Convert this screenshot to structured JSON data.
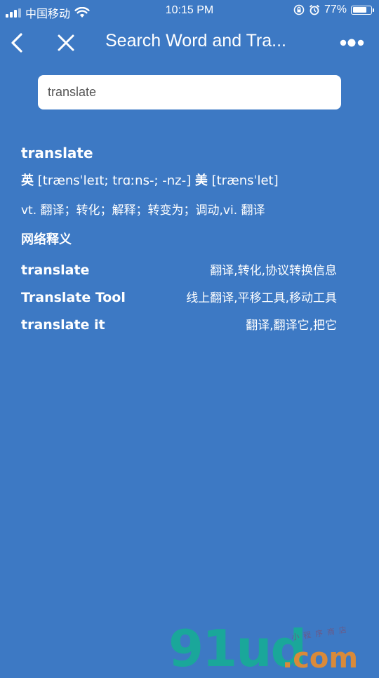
{
  "status_bar": {
    "carrier": "中国移动",
    "time": "10:15 PM",
    "battery": "77%",
    "battery_level": 0.77
  },
  "nav": {
    "title": "Search Word and Tra..."
  },
  "search": {
    "value": "translate"
  },
  "result": {
    "word": "translate",
    "phonetic": {
      "uk_tag": "英",
      "uk": "[trænsˈleɪt; trɑːns-; -nz-]",
      "us_tag": "美",
      "us": "[trænsˈlet]"
    },
    "definition": "vt. 翻译；转化；解释；转变为；调动,vi. 翻译",
    "web_section_title": "网络释义",
    "web_items": [
      {
        "term": "translate",
        "meaning": "翻译,转化,协议转换信息"
      },
      {
        "term": "Translate Tool",
        "meaning": "线上翻译,平移工具,移动工具"
      },
      {
        "term": "translate it",
        "meaning": "翻译,翻译它,把它"
      }
    ]
  },
  "watermark": {
    "main": "91ud",
    "suffix": ".com",
    "small": "小程序商店"
  },
  "colors": {
    "background": "#3d79c4",
    "search_bg": "#ffffff",
    "watermark_teal": "#1aa79a",
    "watermark_orange": "#d98a3a"
  }
}
